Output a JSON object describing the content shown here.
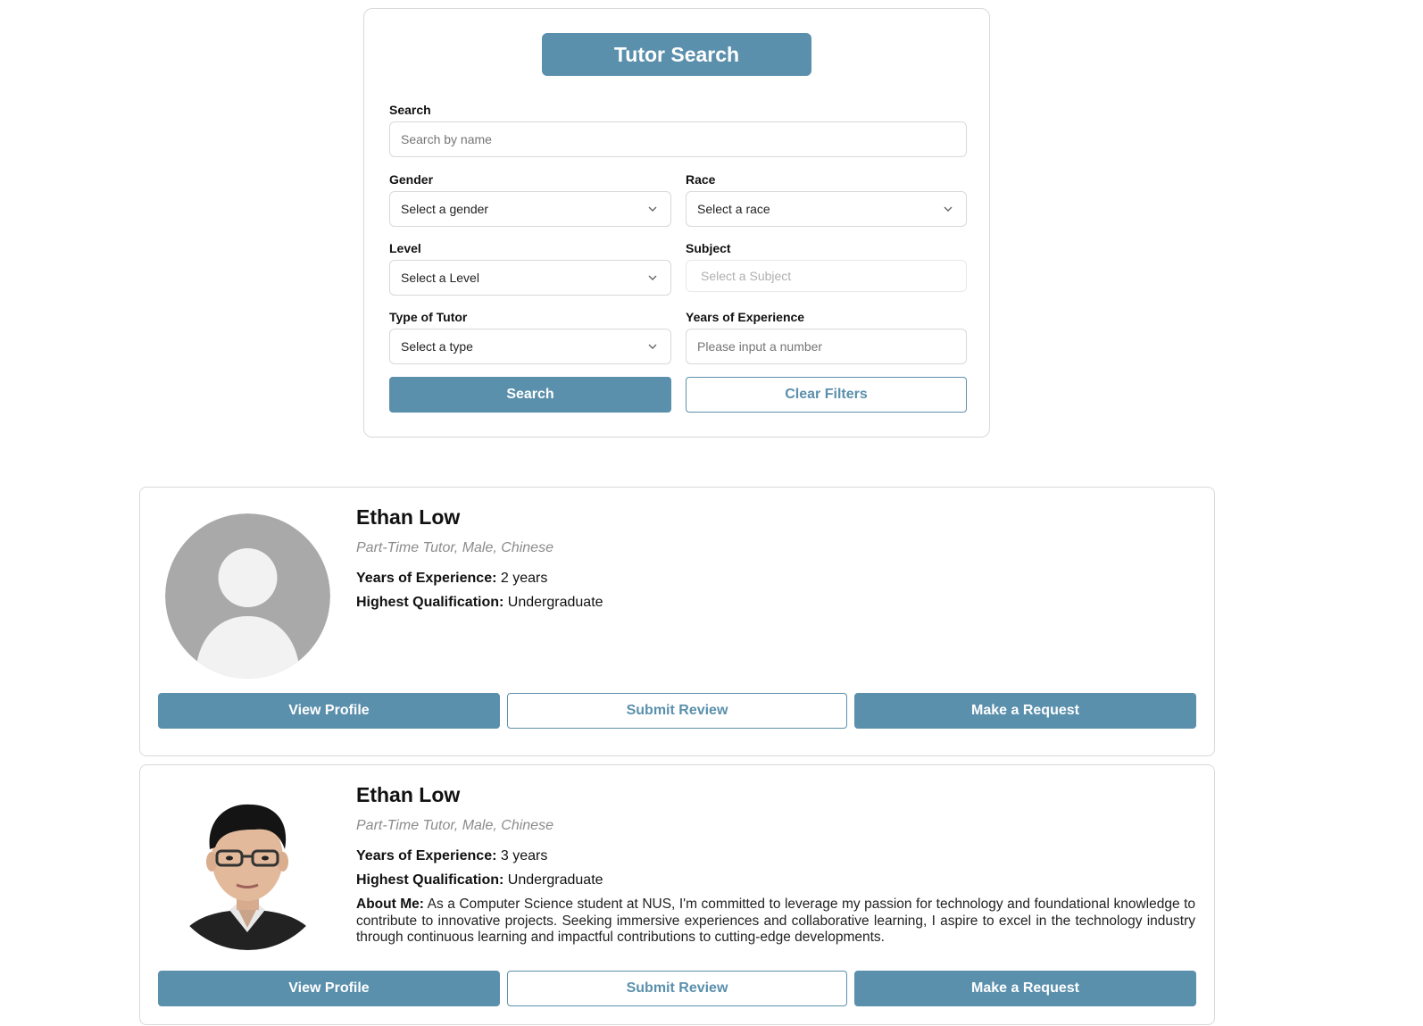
{
  "search_panel": {
    "title": "Tutor Search",
    "search": {
      "label": "Search",
      "placeholder": "Search by name"
    },
    "gender": {
      "label": "Gender",
      "value": "Select a gender"
    },
    "race": {
      "label": "Race",
      "value": "Select a race"
    },
    "level": {
      "label": "Level",
      "value": "Select a Level"
    },
    "subject": {
      "label": "Subject",
      "placeholder": "Select a Subject"
    },
    "tutor_type": {
      "label": "Type of Tutor",
      "value": "Select a type"
    },
    "experience": {
      "label": "Years of Experience",
      "placeholder": "Please input a number"
    },
    "search_button": "Search",
    "clear_button": "Clear Filters"
  },
  "tutors": [
    {
      "name": "Ethan Low",
      "meta": "Part-Time Tutor, Male, Chinese",
      "experience_label": "Years of Experience:",
      "experience_value": "2 years",
      "qualification_label": "Highest Qualification:",
      "qualification_value": "Undergraduate",
      "avatar": "default-avatar-icon",
      "view_profile": "View Profile",
      "submit_review": "Submit Review",
      "make_request": "Make a Request"
    },
    {
      "name": "Ethan Low",
      "meta": "Part-Time Tutor, Male, Chinese",
      "experience_label": "Years of Experience:",
      "experience_value": "3 years",
      "qualification_label": "Highest Qualification:",
      "qualification_value": "Undergraduate",
      "about_label": "About Me:",
      "about_text": "As a Computer Science student at NUS, I'm committed to leverage my passion for technology and foundational knowledge to contribute to innovative projects. Seeking immersive experiences and collaborative learning, I aspire to excel in the technology industry through continuous learning and impactful contributions to cutting-edge developments.",
      "avatar": "portrait-photo",
      "view_profile": "View Profile",
      "submit_review": "Submit Review",
      "make_request": "Make a Request"
    }
  ],
  "colors": {
    "accent": "#5b90ad",
    "border": "#d9d9d9",
    "meta_text": "#8c8c8c"
  }
}
